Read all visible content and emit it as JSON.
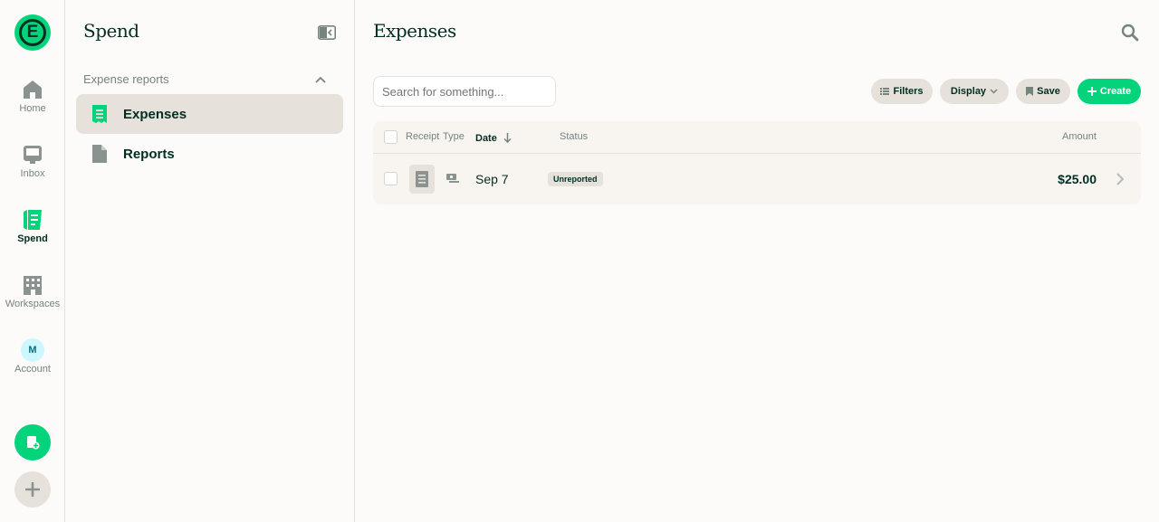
{
  "rail": {
    "logo_letter": "E",
    "items": [
      {
        "label": "Home",
        "icon": "home-icon"
      },
      {
        "label": "Inbox",
        "icon": "inbox-icon"
      },
      {
        "label": "Spend",
        "icon": "receipt-icon"
      },
      {
        "label": "Workspaces",
        "icon": "building-icon"
      },
      {
        "label": "Account",
        "icon": "avatar",
        "initial": "M"
      }
    ]
  },
  "sidebar": {
    "title": "Spend",
    "section": "Expense reports",
    "items": [
      {
        "label": "Expenses",
        "icon": "receipt-icon"
      },
      {
        "label": "Reports",
        "icon": "document-icon"
      }
    ]
  },
  "main": {
    "title": "Expenses",
    "search_placeholder": "Search for something...",
    "buttons": {
      "filters": "Filters",
      "display": "Display",
      "save": "Save",
      "create": "Create"
    },
    "columns": {
      "receipt": "Receipt",
      "type": "Type",
      "date": "Date",
      "status": "Status",
      "amount": "Amount"
    },
    "rows": [
      {
        "date": "Sep 7",
        "status": "Unreported",
        "amount": "$25.00"
      }
    ]
  },
  "colors": {
    "accent": "#03d47c",
    "text": "#002e22",
    "muted": "#76847e",
    "border": "#e6e1da"
  }
}
